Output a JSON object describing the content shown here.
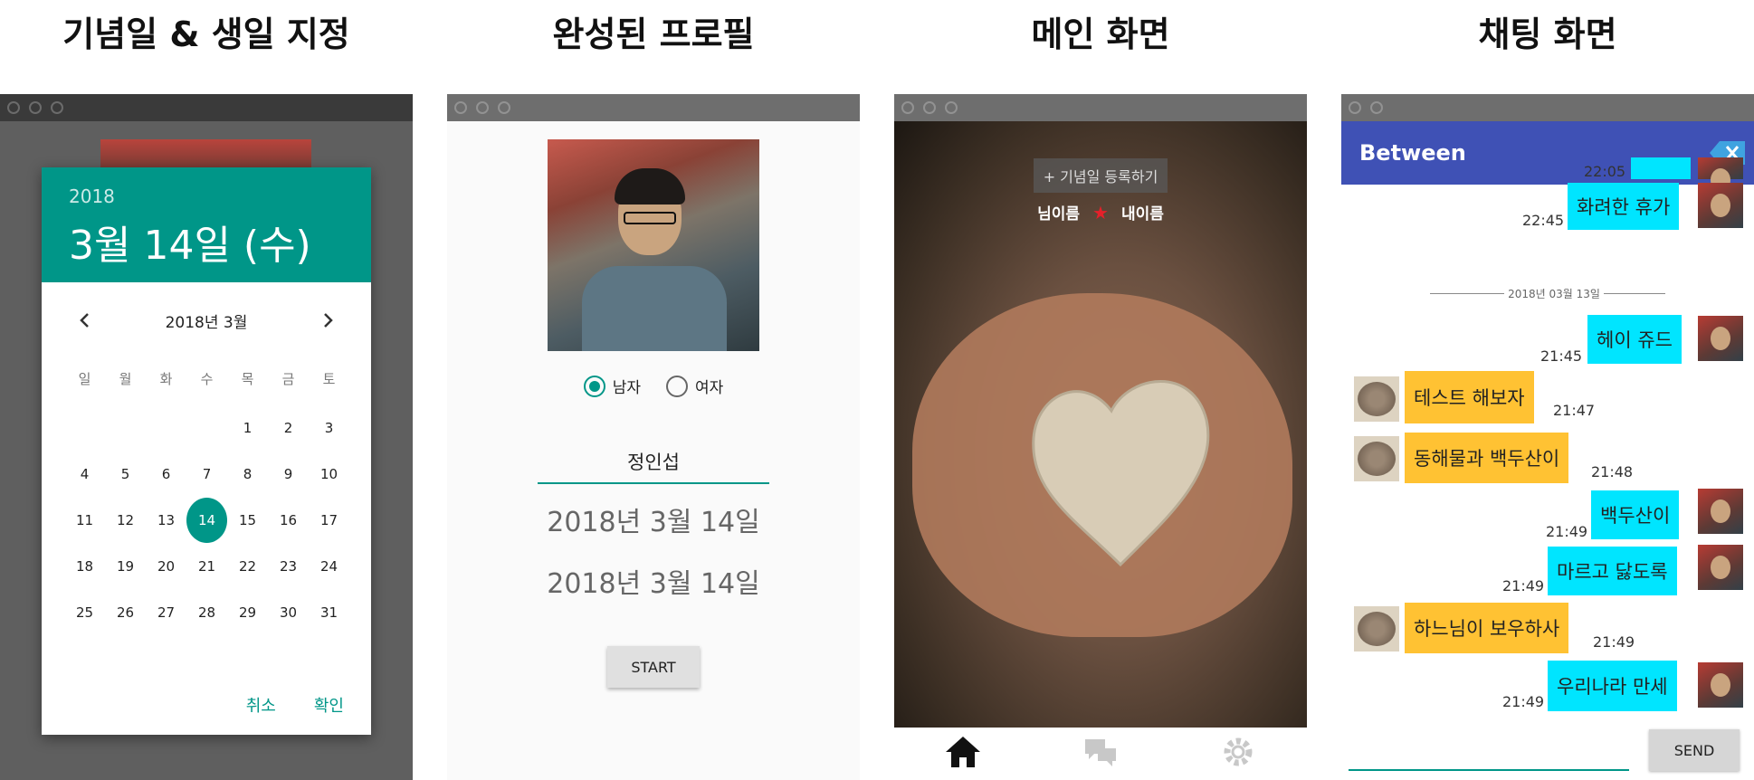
{
  "headings": {
    "p1": "기념일 & 생일 지정",
    "p2": "완성된 프로필",
    "p3": "메인 화면",
    "p4": "채팅 화면"
  },
  "datepicker": {
    "year": "2018",
    "selected_date": "3월 14일 (수)",
    "month_label": "2018년 3월",
    "weekdays": [
      "일",
      "월",
      "화",
      "수",
      "목",
      "금",
      "토"
    ],
    "weeks": [
      [
        "",
        "",
        "",
        "",
        "1",
        "2",
        "3"
      ],
      [
        "4",
        "5",
        "6",
        "7",
        "8",
        "9",
        "10"
      ],
      [
        "11",
        "12",
        "13",
        "14",
        "15",
        "16",
        "17"
      ],
      [
        "18",
        "19",
        "20",
        "21",
        "22",
        "23",
        "24"
      ],
      [
        "25",
        "26",
        "27",
        "28",
        "29",
        "30",
        "31"
      ]
    ],
    "selected_day": "14",
    "cancel_label": "취소",
    "ok_label": "확인",
    "accent": "#009688"
  },
  "profile": {
    "gender_male": "남자",
    "gender_female": "여자",
    "gender_selected": "남자",
    "name": "정인섭",
    "date1": "2018년 3월 14일",
    "date2": "2018년 3월 14일",
    "start_label": "START"
  },
  "main": {
    "anniversary_button": "+ 기념일 등록하기",
    "partner_name": "님이름",
    "my_name": "내이름",
    "tabs": [
      "home-icon",
      "chat-icon",
      "settings-icon"
    ]
  },
  "chat": {
    "title": "Between",
    "date_divider": "2018년 03월 13일",
    "send_label": "SEND",
    "messages": [
      {
        "from": "me",
        "text": "",
        "time": "22:05"
      },
      {
        "from": "me",
        "text": "화려한 휴가",
        "time": "22:45"
      },
      {
        "from": "me",
        "text": "헤이 쥬드",
        "time": "21:45"
      },
      {
        "from": "other",
        "text": "테스트 해보자",
        "time": "21:47"
      },
      {
        "from": "other",
        "text": "동해물과 백두산이",
        "time": "21:48"
      },
      {
        "from": "me",
        "text": "백두산이",
        "time": "21:49"
      },
      {
        "from": "me",
        "text": "마르고 닳도록",
        "time": "21:49"
      },
      {
        "from": "other",
        "text": "하느님이 보우하사",
        "time": "21:49"
      },
      {
        "from": "me",
        "text": "우리나라 만세",
        "time": "21:49"
      }
    ],
    "colors": {
      "me": "#00e5ff",
      "other": "#ffc233",
      "appbar": "#3f51b5"
    }
  }
}
